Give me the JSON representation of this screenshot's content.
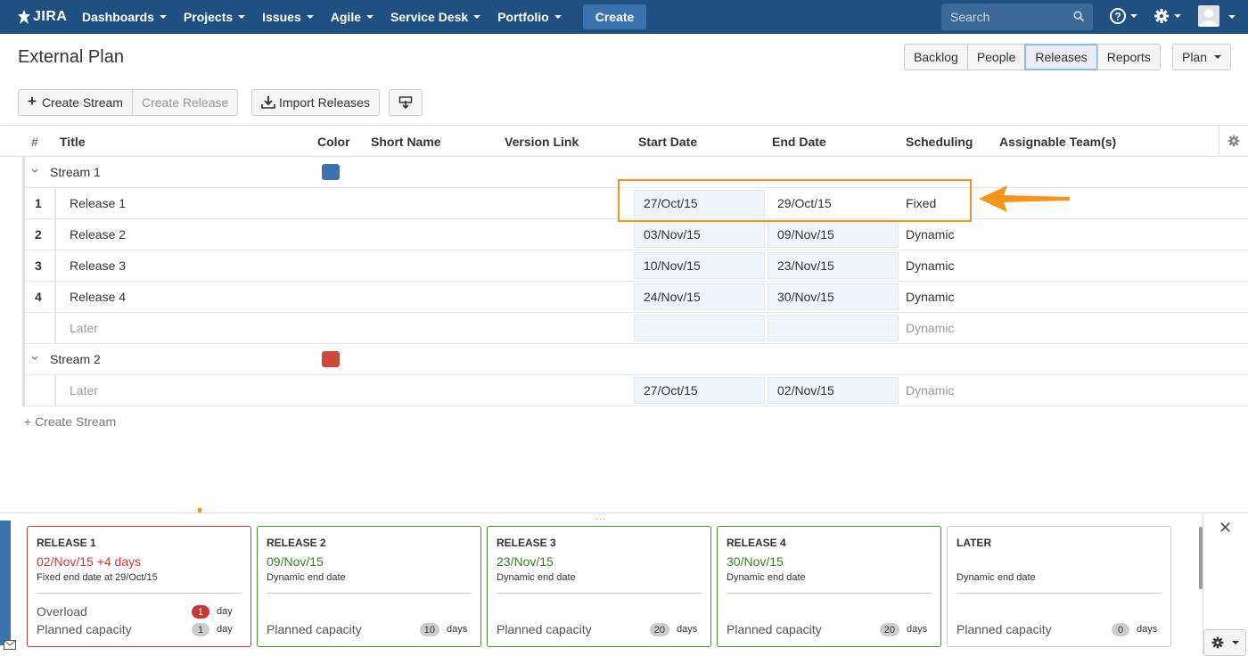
{
  "nav": {
    "logo": "JIRA",
    "items": [
      "Dashboards",
      "Projects",
      "Issues",
      "Agile",
      "Service Desk",
      "Portfolio"
    ],
    "create": "Create",
    "search_placeholder": "Search"
  },
  "header": {
    "title": "External Plan",
    "views": [
      "Backlog",
      "People",
      "Releases",
      "Reports"
    ],
    "active_view": "Releases",
    "plan": "Plan"
  },
  "toolbar": {
    "create_stream": "Create Stream",
    "create_release": "Create Release",
    "import_releases": "Import Releases"
  },
  "table": {
    "headers": {
      "hash": "#",
      "title": "Title",
      "color": "Color",
      "short_name": "Short Name",
      "version_link": "Version Link",
      "start_date": "Start Date",
      "end_date": "End Date",
      "scheduling": "Scheduling",
      "teams": "Assignable Team(s)"
    },
    "stream1": {
      "name": "Stream 1",
      "color": "#3b73af",
      "releases": [
        {
          "num": "1",
          "title": "Release 1",
          "start": "27/Oct/15",
          "end": "29/Oct/15",
          "scheduling": "Fixed"
        },
        {
          "num": "2",
          "title": "Release 2",
          "start": "03/Nov/15",
          "end": "09/Nov/15",
          "scheduling": "Dynamic"
        },
        {
          "num": "3",
          "title": "Release 3",
          "start": "10/Nov/15",
          "end": "23/Nov/15",
          "scheduling": "Dynamic"
        },
        {
          "num": "4",
          "title": "Release 4",
          "start": "24/Nov/15",
          "end": "30/Nov/15",
          "scheduling": "Dynamic"
        }
      ],
      "later": {
        "title": "Later",
        "start": "",
        "end": "",
        "scheduling": "Dynamic"
      }
    },
    "stream2": {
      "name": "Stream 2",
      "color": "#c84a3c",
      "later": {
        "title": "Later",
        "start": "27/Oct/15",
        "end": "02/Nov/15",
        "scheduling": "Dynamic"
      }
    },
    "create_stream_link": "+ Create Stream"
  },
  "cards": [
    {
      "title": "RELEASE 1",
      "date": "02/Nov/15 +4 days",
      "sub": "Fixed end date at 29/Oct/15",
      "overload_label": "Overload",
      "overload_value": "1",
      "overload_unit": "day",
      "capacity_label": "Planned capacity",
      "capacity_value": "1",
      "capacity_unit": "day"
    },
    {
      "title": "RELEASE 2",
      "date": "09/Nov/15",
      "sub": "Dynamic end date",
      "capacity_label": "Planned capacity",
      "capacity_value": "10",
      "capacity_unit": "days"
    },
    {
      "title": "RELEASE 3",
      "date": "23/Nov/15",
      "sub": "Dynamic end date",
      "capacity_label": "Planned capacity",
      "capacity_value": "20",
      "capacity_unit": "days"
    },
    {
      "title": "RELEASE 4",
      "date": "30/Nov/15",
      "sub": "Dynamic end date",
      "capacity_label": "Planned capacity",
      "capacity_value": "20",
      "capacity_unit": "days"
    },
    {
      "title": "LATER",
      "date": "",
      "sub": "Dynamic end date",
      "capacity_label": "Planned capacity",
      "capacity_value": "0",
      "capacity_unit": "days"
    }
  ],
  "bottom": {
    "grip": "...",
    "close": "✕"
  },
  "colors": {
    "accent": "#205081",
    "highlight": "#f7941d",
    "overload": "#c83737",
    "ok": "#3b7d23"
  }
}
